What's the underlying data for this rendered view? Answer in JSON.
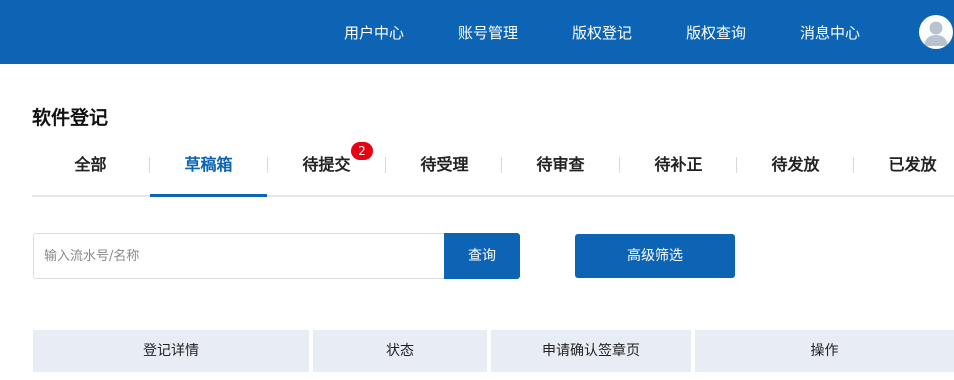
{
  "header": {
    "nav": [
      "用户中心",
      "账号管理",
      "版权登记",
      "版权查询",
      "消息中心"
    ],
    "avatar_icon": "user-avatar-icon"
  },
  "page_title": "软件登记",
  "tabs": [
    {
      "label": "全部",
      "active": false
    },
    {
      "label": "草稿箱",
      "active": true
    },
    {
      "label": "待提交",
      "active": false,
      "badge": "2"
    },
    {
      "label": "待受理",
      "active": false
    },
    {
      "label": "待审查",
      "active": false
    },
    {
      "label": "待补正",
      "active": false
    },
    {
      "label": "待发放",
      "active": false
    },
    {
      "label": "已发放",
      "active": false
    }
  ],
  "search": {
    "placeholder": "输入流水号/名称",
    "value": "",
    "button_label": "查询"
  },
  "filter_button": "高级筛选",
  "table": {
    "columns": [
      "登记详情",
      "状态",
      "申请确认签章页",
      "操作"
    ]
  },
  "colors": {
    "primary": "#0d64b4",
    "badge": "#e60012",
    "table_header_bg": "#e8ecf4"
  }
}
